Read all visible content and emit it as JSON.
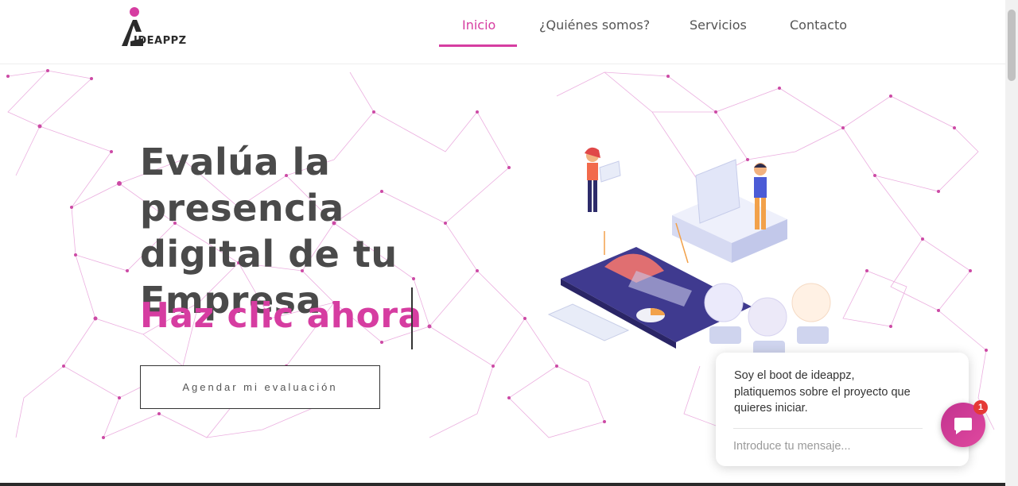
{
  "brand": {
    "logo_text": "IDEAPPZ"
  },
  "nav": {
    "items": [
      {
        "label": "Inicio",
        "active": true
      },
      {
        "label": "¿Quiénes somos?",
        "active": false
      },
      {
        "label": "Servicios",
        "active": false
      },
      {
        "label": "Contacto",
        "active": false
      }
    ]
  },
  "hero": {
    "headline_line1": "Evalúa la presencia",
    "headline_line2": "digital de tu",
    "headline_line3": "Empresa",
    "typed_text": "Haz clic ahora",
    "cta_label": "Agendar mi evaluación"
  },
  "chat": {
    "message": "Soy el boot de ideappz, platiquemos sobre el proyecto que quieres iniciar.",
    "input_placeholder": "Introduce tu mensaje...",
    "badge_count": "1"
  },
  "colors": {
    "accent": "#d63da1",
    "text": "#4a4a4a",
    "network": "#e08ad0"
  }
}
